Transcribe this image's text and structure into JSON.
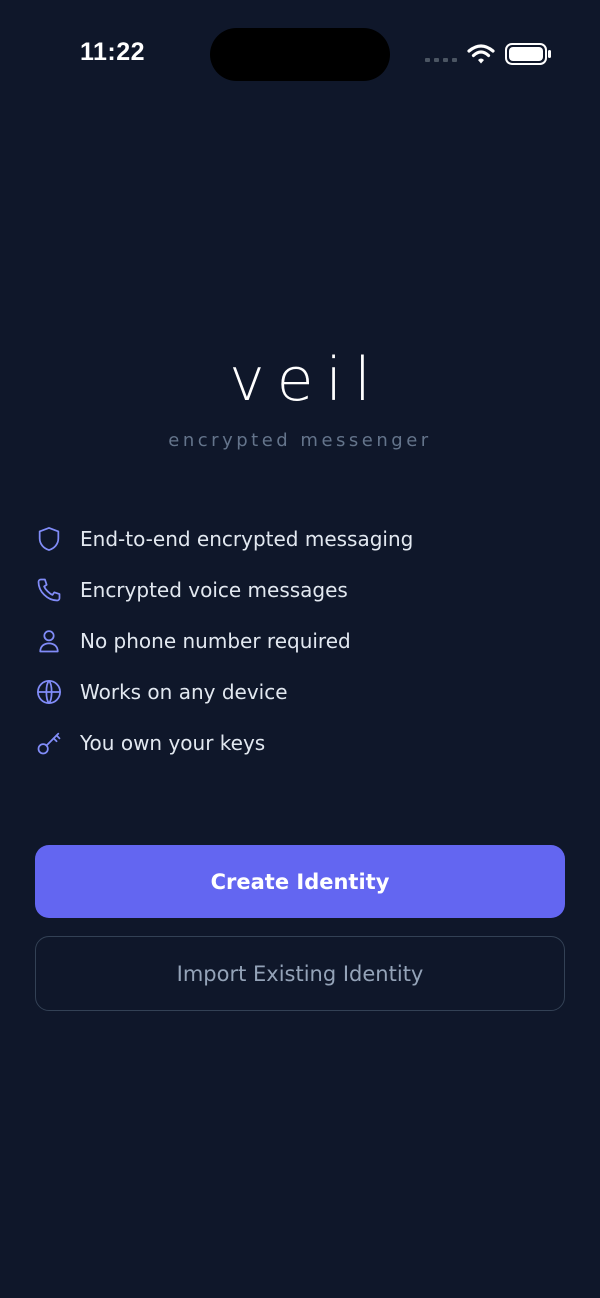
{
  "status_bar": {
    "time": "11:22",
    "icons": [
      "signal-icon",
      "wifi-icon",
      "battery-icon"
    ]
  },
  "brand": {
    "logo": "veil",
    "tagline": "encrypted messenger"
  },
  "features": [
    {
      "icon": "shield-icon",
      "label": "End-to-end encrypted messaging"
    },
    {
      "icon": "phone-icon",
      "label": "Encrypted voice messages"
    },
    {
      "icon": "user-icon",
      "label": "No phone number required"
    },
    {
      "icon": "globe-icon",
      "label": "Works on any device"
    },
    {
      "icon": "key-icon",
      "label": "You own your keys"
    }
  ],
  "actions": {
    "create_label": "Create Identity",
    "import_label": "Import Existing Identity"
  },
  "colors": {
    "background": "#0f172a",
    "accent": "#6366f1",
    "icon_accent": "#818cf8",
    "muted_text": "#64748b",
    "secondary_border": "#334155"
  }
}
